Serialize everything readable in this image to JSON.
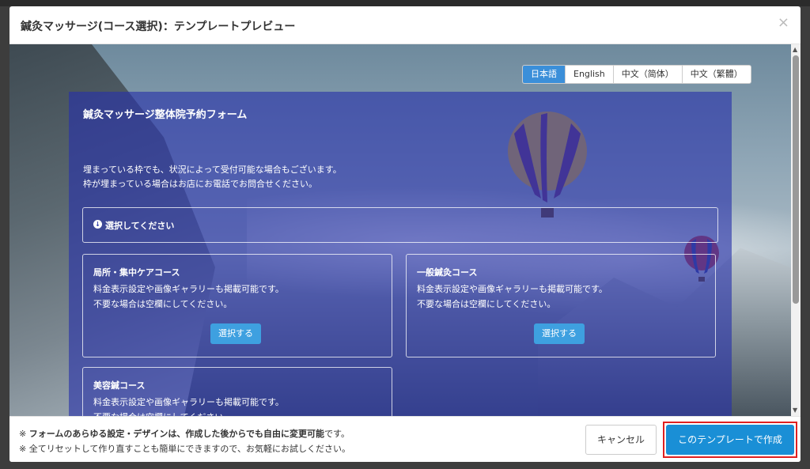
{
  "modal": {
    "title": "鍼灸マッサージ(コース選択)：テンプレートプレビュー",
    "close_icon": "×"
  },
  "languages": {
    "selected": "日本語",
    "items": [
      "日本語",
      "English",
      "中文（简体）",
      "中文（繁體）"
    ]
  },
  "form": {
    "title": "鍼灸マッサージ整体院予約フォーム",
    "notice_line1": "埋まっている枠でも、状況によって受付可能な場合もございます。",
    "notice_line2": "枠が埋まっている場合はお店にお電話でお問合せください。",
    "select_label": "選択してください",
    "courses": [
      {
        "title": "局所・集中ケアコース",
        "desc_line1": "料金表示設定や画像ギャラリーも掲載可能です。",
        "desc_line2": "不要な場合は空欄にしてください。",
        "button": "選択する"
      },
      {
        "title": "一般鍼灸コース",
        "desc_line1": "料金表示設定や画像ギャラリーも掲載可能です。",
        "desc_line2": "不要な場合は空欄にしてください。",
        "button": "選択する"
      },
      {
        "title": "美容鍼コース",
        "desc_line1": "料金表示設定や画像ギャラリーも掲載可能です。",
        "desc_line2": "不要な場合は空欄にしてください。"
      }
    ]
  },
  "footer": {
    "note1_prefix": "※ ",
    "note1_bold": "フォームのあらゆる設定・デザインは、作成した後からでも自由に変更可能",
    "note1_suffix": "です。",
    "note2": "※ 全てリセットして作り直すことも簡単にできますので、お気軽にお試しください。",
    "cancel_label": "キャンセル",
    "create_label": "このテンプレートで作成"
  },
  "colors": {
    "accent": "#1a8fd6",
    "overlay": "#2630aa",
    "highlight": "#e02020"
  }
}
